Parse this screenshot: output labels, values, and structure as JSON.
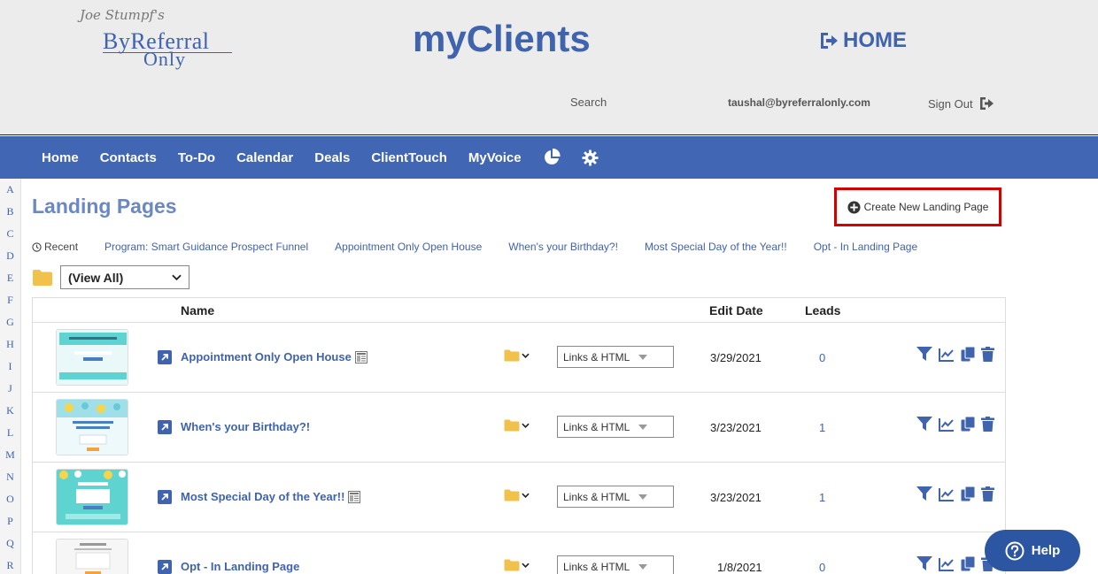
{
  "header": {
    "logo_script": "Joe Stumpf's",
    "logo_line1": "ByReferral",
    "logo_line2": "Only",
    "app_title": "myClients",
    "home_label": "HOME",
    "search_label": "Search",
    "user_email": "taushal@byreferralonly.com",
    "signout_label": "Sign Out"
  },
  "nav": {
    "items": [
      "Home",
      "Contacts",
      "To-Do",
      "Calendar",
      "Deals",
      "ClientTouch",
      "MyVoice"
    ],
    "icons": [
      "pie-chart-icon",
      "gear-icon"
    ]
  },
  "alphabet": [
    "A",
    "B",
    "C",
    "D",
    "E",
    "F",
    "G",
    "H",
    "I",
    "J",
    "K",
    "L",
    "M",
    "N",
    "O",
    "P",
    "Q",
    "R"
  ],
  "page": {
    "title": "Landing Pages",
    "create_button": "Create New Landing Page"
  },
  "recent": {
    "label": "Recent",
    "links": [
      "Program: Smart Guidance Prospect Funnel",
      "Appointment Only Open House",
      "When's your Birthday?!",
      "Most Special Day of the Year!!",
      "Opt - In Landing Page"
    ]
  },
  "folder_filter": {
    "selected": "(View All)"
  },
  "table": {
    "headers": {
      "name": "Name",
      "edit_date": "Edit Date",
      "leads": "Leads"
    },
    "rows": [
      {
        "name": "Appointment Only Open House",
        "has_doc_icon": true,
        "links_value": "Links & HTML",
        "edit_date": "3/29/2021",
        "leads": "0",
        "thumb_style": "teal"
      },
      {
        "name": "When's your Birthday?!",
        "has_doc_icon": false,
        "links_value": "Links & HTML",
        "edit_date": "3/23/2021",
        "leads": "1",
        "thumb_style": "balloons"
      },
      {
        "name": "Most Special Day of the Year!!",
        "has_doc_icon": true,
        "links_value": "Links & HTML",
        "edit_date": "3/23/2021",
        "leads": "1",
        "thumb_style": "balloons-teal"
      },
      {
        "name": "Opt - In Landing Page",
        "has_doc_icon": false,
        "links_value": "Links & HTML",
        "edit_date": "1/8/2021",
        "leads": "0",
        "thumb_style": "plain"
      }
    ]
  },
  "help": {
    "label": "Help"
  },
  "colors": {
    "brand_blue": "#4166b3",
    "link_blue": "#3f63ad",
    "highlight_red": "#d40000",
    "folder_yellow": "#f0c24b"
  }
}
